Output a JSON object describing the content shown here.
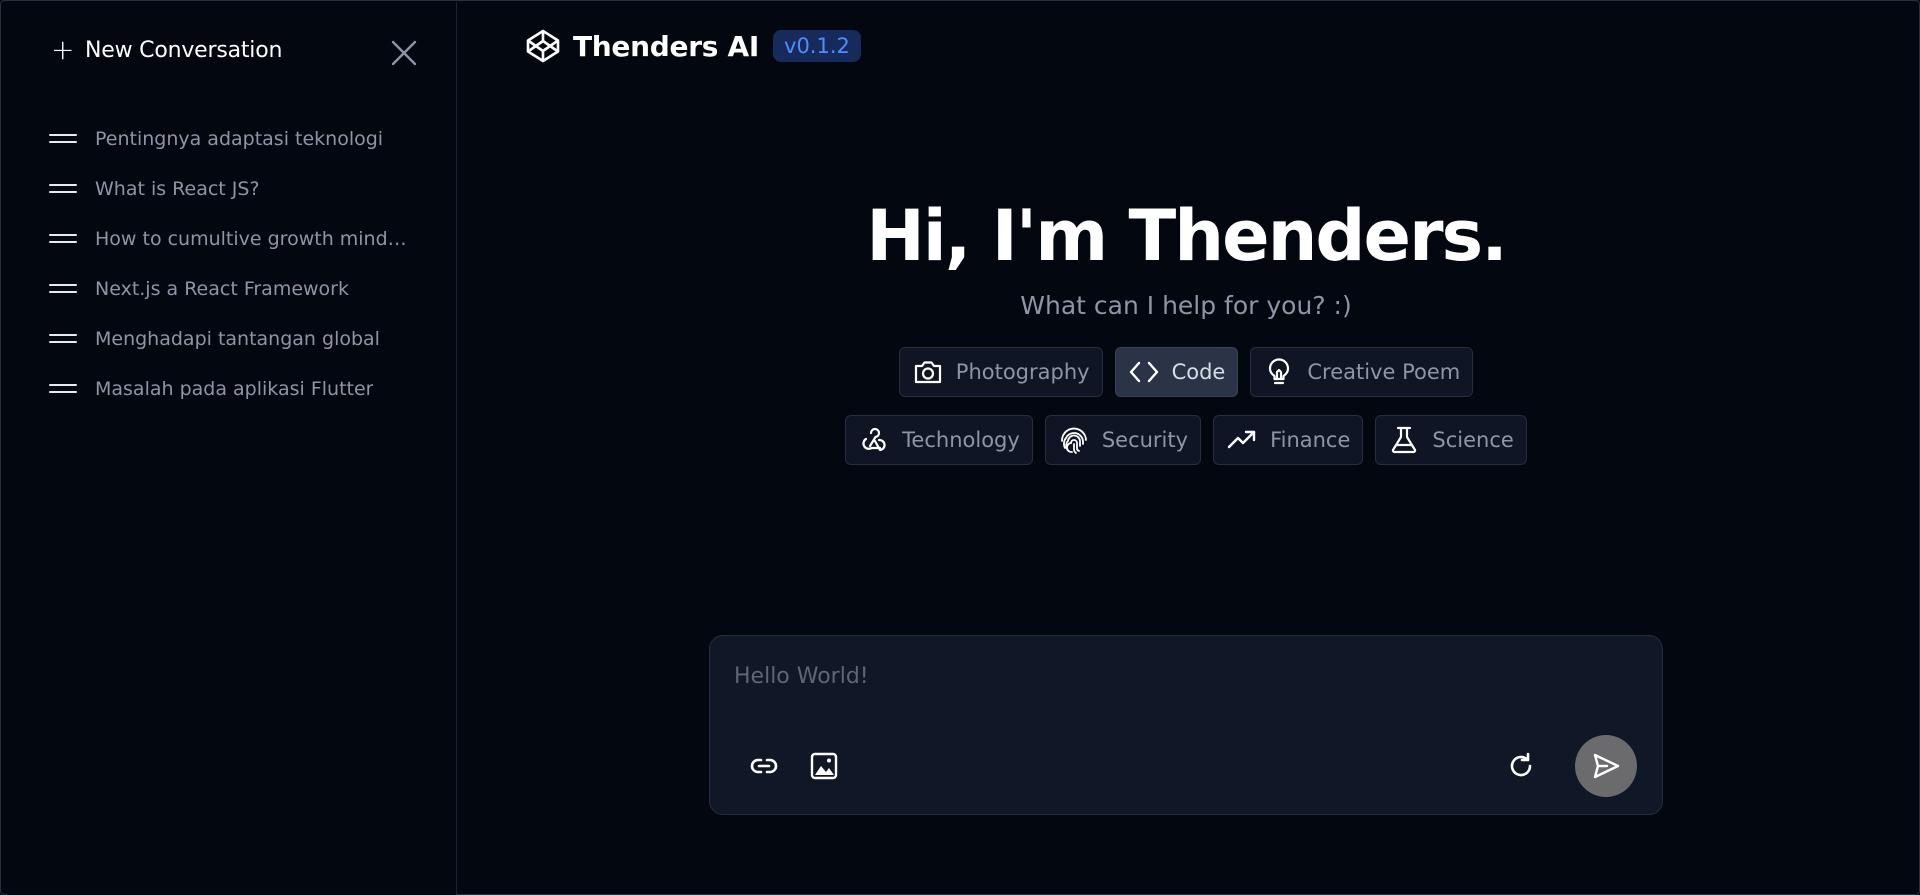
{
  "sidebar": {
    "new_conversation_label": "New Conversation",
    "history": [
      {
        "title": "Pentingnya adaptasi teknologi"
      },
      {
        "title": "What is React JS?"
      },
      {
        "title": "How to cumultive growth minds..."
      },
      {
        "title": "Next.js a React Framework"
      },
      {
        "title": "Menghadapi tantangan global"
      },
      {
        "title": "Masalah pada aplikasi Flutter"
      }
    ]
  },
  "header": {
    "app_name": "Thenders AI",
    "version": "v0.1.2"
  },
  "hero": {
    "title": "Hi, I'm Thenders.",
    "subtitle": "What can I help for you? :)"
  },
  "topics": [
    {
      "label": "Photography",
      "icon": "camera-icon",
      "active": false
    },
    {
      "label": "Code",
      "icon": "code-icon",
      "active": true
    },
    {
      "label": "Creative Poem",
      "icon": "lightbulb-icon",
      "active": false
    },
    {
      "label": "Technology",
      "icon": "webhook-icon",
      "active": false
    },
    {
      "label": "Security",
      "icon": "fingerprint-icon",
      "active": false
    },
    {
      "label": "Finance",
      "icon": "trending-up-icon",
      "active": false
    },
    {
      "label": "Science",
      "icon": "flask-icon",
      "active": false
    }
  ],
  "composer": {
    "placeholder": "Hello World!",
    "value": ""
  },
  "colors": {
    "background": "#03070f",
    "panel": "#101727",
    "accent": "#4f8cff",
    "badge_bg": "#172a5c",
    "muted_text": "#8d95a6",
    "send_button": "#6b6b6e"
  }
}
